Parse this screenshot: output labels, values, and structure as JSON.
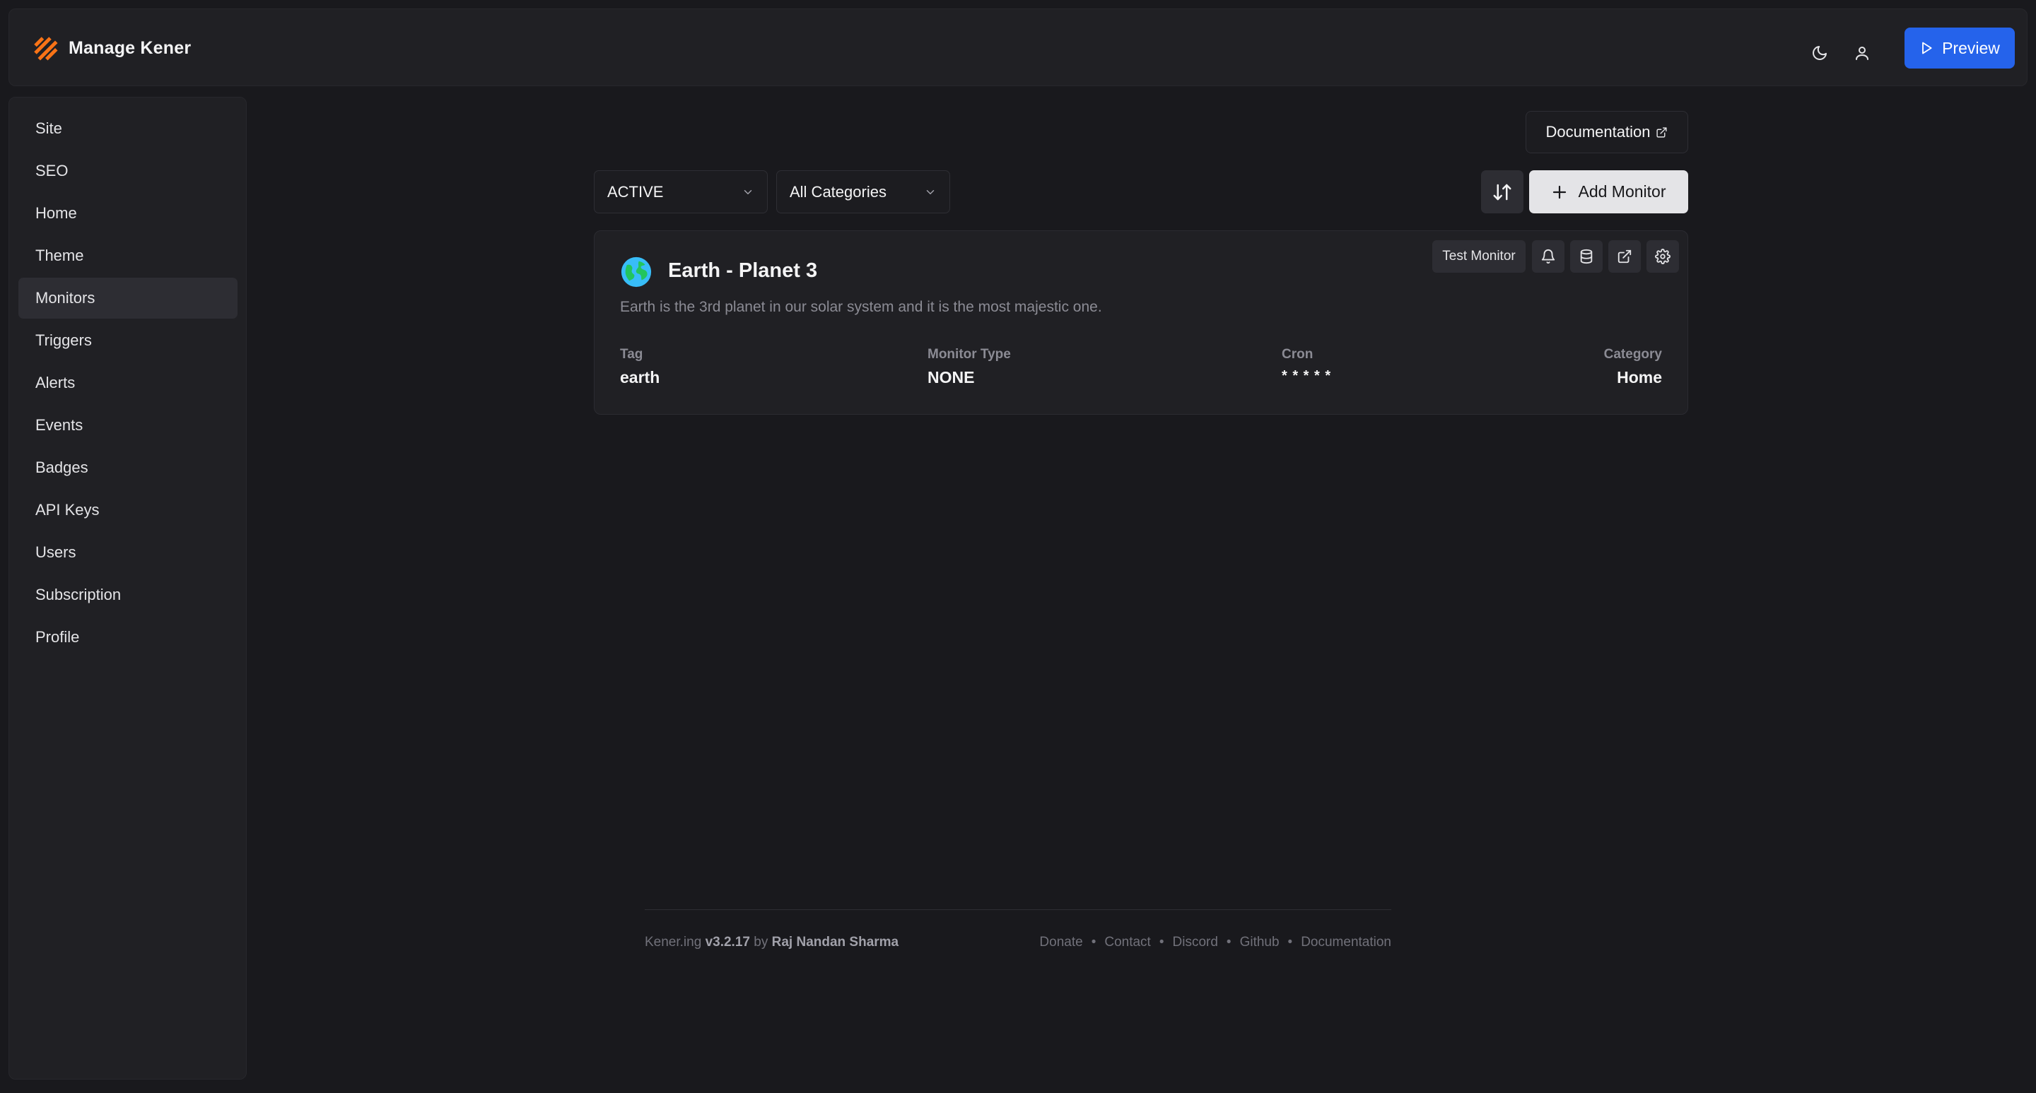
{
  "header": {
    "title": "Manage Kener",
    "preview_label": "Preview"
  },
  "sidebar": {
    "items": [
      {
        "label": "Site"
      },
      {
        "label": "SEO"
      },
      {
        "label": "Home"
      },
      {
        "label": "Theme"
      },
      {
        "label": "Monitors",
        "active": true
      },
      {
        "label": "Triggers"
      },
      {
        "label": "Alerts"
      },
      {
        "label": "Events"
      },
      {
        "label": "Badges"
      },
      {
        "label": "API Keys"
      },
      {
        "label": "Users"
      },
      {
        "label": "Subscription"
      },
      {
        "label": "Profile"
      }
    ]
  },
  "toolbar": {
    "documentation_label": "Documentation",
    "status_filter": "ACTIVE",
    "category_filter": "All Categories",
    "add_label": "Add Monitor"
  },
  "monitor": {
    "title": "Earth - Planet 3",
    "description": "Earth is the 3rd planet in our solar system and it is the most majestic one.",
    "test_label": "Test Monitor",
    "tag_label": "Tag",
    "tag_value": "earth",
    "type_label": "Monitor Type",
    "type_value": "NONE",
    "cron_label": "Cron",
    "cron_value": "* * * * *",
    "category_label": "Category",
    "category_value": "Home"
  },
  "footer": {
    "brand": "Kener.ing",
    "version": "v3.2.17",
    "by": "by",
    "author": "Raj Nandan Sharma",
    "links": [
      "Donate",
      "Contact",
      "Discord",
      "Github",
      "Documentation"
    ]
  },
  "colors": {
    "accent": "#2563eb",
    "logo": "#f97316",
    "background": "#19191d",
    "panel": "#202024"
  }
}
